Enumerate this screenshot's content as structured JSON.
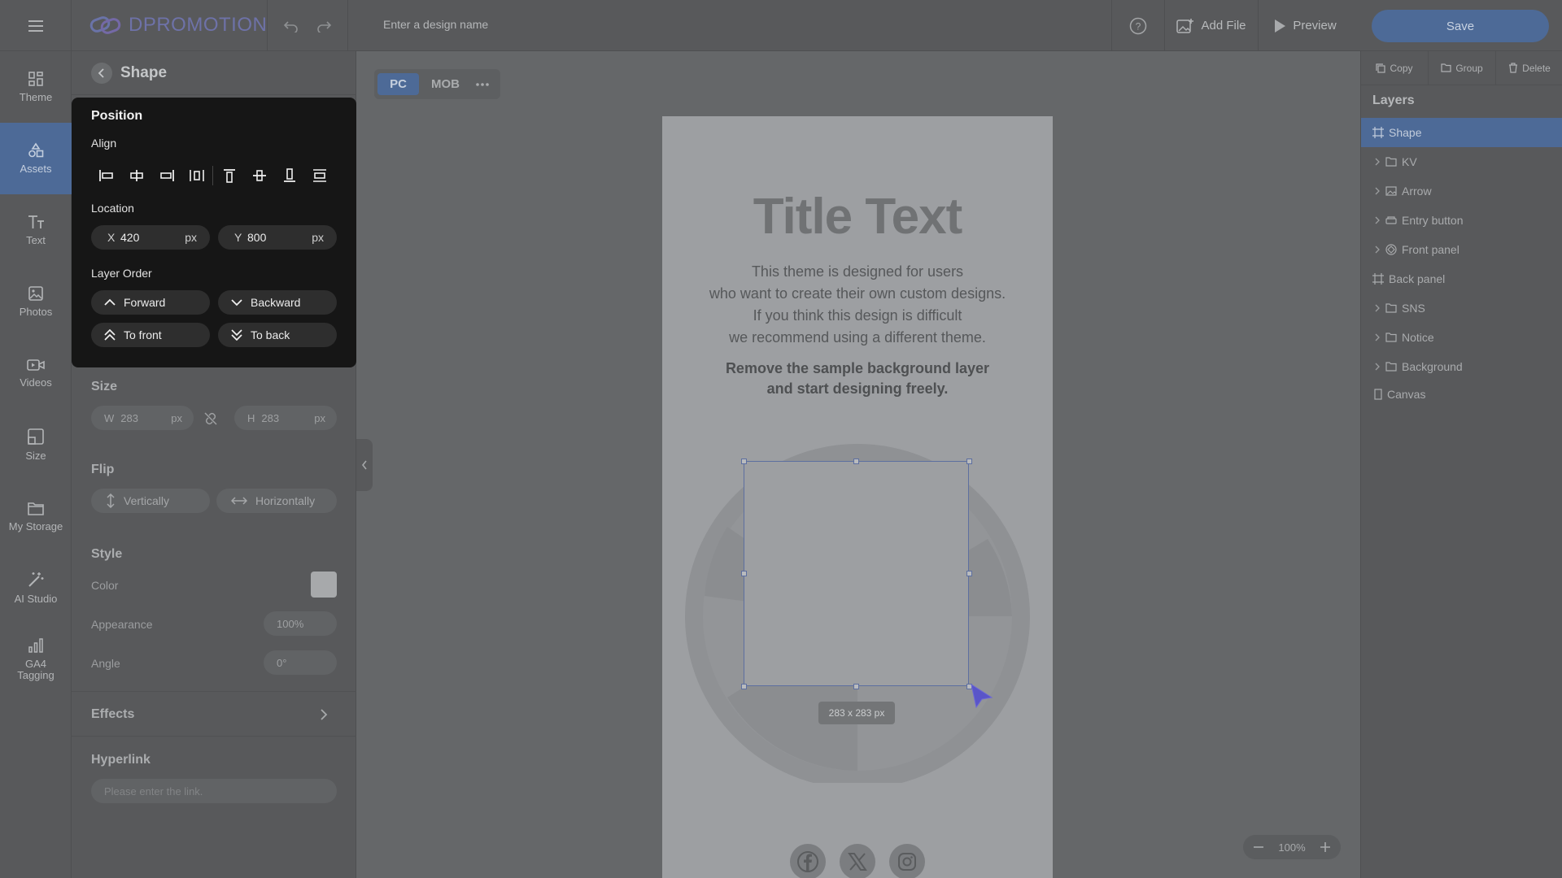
{
  "app": {
    "brand": "DPROMOTION",
    "design_name_placeholder": "Enter a design name",
    "add_file_label": "Add File",
    "preview_label": "Preview",
    "save_label": "Save"
  },
  "rail": {
    "items": [
      {
        "label": "Theme",
        "icon": "theme-icon"
      },
      {
        "label": "Assets",
        "icon": "assets-icon",
        "active": true
      },
      {
        "label": "Text",
        "icon": "text-icon"
      },
      {
        "label": "Photos",
        "icon": "photos-icon"
      },
      {
        "label": "Videos",
        "icon": "videos-icon"
      },
      {
        "label": "Size",
        "icon": "size-icon"
      },
      {
        "label": "My Storage",
        "icon": "folder-icon"
      },
      {
        "label": "AI Studio",
        "icon": "magic-wand-icon"
      },
      {
        "label": "GA4 Tagging",
        "icon": "bar-chart-icon"
      }
    ]
  },
  "panel": {
    "title": "Shape",
    "position": {
      "title": "Position",
      "align_label": "Align",
      "location_label": "Location",
      "x_key": "X",
      "x_value": "420",
      "y_key": "Y",
      "y_value": "800",
      "unit": "px",
      "layer_order_label": "Layer Order",
      "forward": "Forward",
      "backward": "Backward",
      "to_front": "To front",
      "to_back": "To back"
    },
    "size": {
      "title": "Size",
      "w_key": "W",
      "w_value": "283",
      "h_key": "H",
      "h_value": "283",
      "unit": "px"
    },
    "flip": {
      "title": "Flip",
      "vertically": "Vertically",
      "horizontally": "Horizontally"
    },
    "style": {
      "title": "Style",
      "color_label": "Color",
      "color_value": "#a7a9ab",
      "appearance_label": "Appearance",
      "appearance_value": "100%",
      "angle_label": "Angle",
      "angle_value": "0°"
    },
    "effects_label": "Effects",
    "hyperlink": {
      "title": "Hyperlink",
      "placeholder": "Please enter the link."
    }
  },
  "canvas": {
    "tabs": [
      "PC",
      "MOB"
    ],
    "active_tab": "PC",
    "title_text": "Title Text",
    "body_lines": [
      "This theme is designed for users",
      "who want to create their own custom designs.",
      "If you think this design is difficult",
      "we recommend using a different theme."
    ],
    "bold_lines": [
      "Remove the sample background layer",
      "and start designing freely."
    ],
    "selection_size": "283 x 283 px",
    "social_icons": [
      "facebook-icon",
      "x-icon",
      "instagram-icon"
    ],
    "zoom": "100%"
  },
  "layers": {
    "actions": [
      {
        "label": "Copy",
        "icon": "copy-icon"
      },
      {
        "label": "Group",
        "icon": "folder-icon"
      },
      {
        "label": "Delete",
        "icon": "trash-icon"
      }
    ],
    "title": "Layers",
    "items": [
      {
        "label": "Shape",
        "icon": "frame-icon",
        "active": true,
        "expandable": false
      },
      {
        "label": "KV",
        "icon": "folder-icon",
        "expandable": true
      },
      {
        "label": "Arrow",
        "icon": "image-icon",
        "expandable": true
      },
      {
        "label": "Entry button",
        "icon": "button-icon",
        "expandable": true
      },
      {
        "label": "Front panel",
        "icon": "component-icon",
        "expandable": true
      },
      {
        "label": "Back panel",
        "icon": "frame-icon",
        "expandable": false
      },
      {
        "label": "SNS",
        "icon": "folder-icon",
        "expandable": true
      },
      {
        "label": "Notice",
        "icon": "folder-icon",
        "expandable": true
      },
      {
        "label": "Background",
        "icon": "folder-icon",
        "expandable": true
      },
      {
        "label": "Canvas",
        "icon": "page-icon",
        "expandable": false
      }
    ]
  },
  "colors": {
    "accent": "#4d6a97",
    "popup_bg": "#161616",
    "cursor": "#5a55c8"
  }
}
